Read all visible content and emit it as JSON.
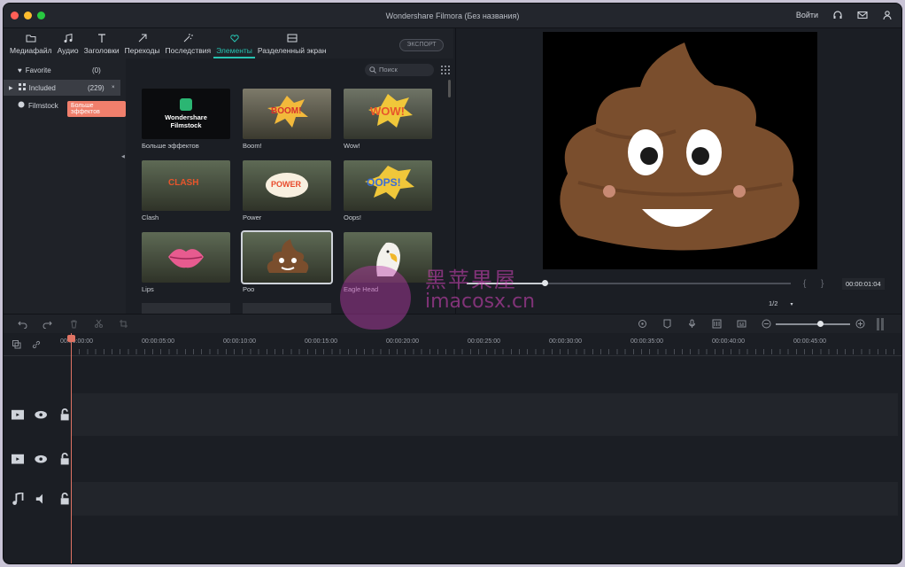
{
  "window": {
    "title": "Wondershare Filmora (Без названия)"
  },
  "titlebar": {
    "login_label": "Войти"
  },
  "toolbar": {
    "tabs": [
      {
        "label": "Медиафайл",
        "icon": "folder-icon"
      },
      {
        "label": "Аудио",
        "icon": "music-note-icon"
      },
      {
        "label": "Заголовки",
        "icon": "text-title-icon"
      },
      {
        "label": "Переходы",
        "icon": "transition-icon"
      },
      {
        "label": "Последствия",
        "icon": "effects-icon"
      },
      {
        "label": "Элементы",
        "icon": "elements-icon",
        "active": true
      },
      {
        "label": "Разделенный экран",
        "icon": "split-screen-icon"
      }
    ],
    "export_label": "ЭКСПОРТ"
  },
  "sidebar": {
    "items": [
      {
        "label": "Favorite",
        "count": "(0)"
      },
      {
        "label": "Included",
        "count": "(229)"
      },
      {
        "label": "Filmstock",
        "count": ""
      }
    ],
    "tooltip": "Больше эффектов"
  },
  "library": {
    "search_placeholder": "Поиск",
    "items": [
      {
        "label": "Больше эффектов",
        "caption": "Wondershare Filmstock"
      },
      {
        "label": "Boom!",
        "caption": "BOOM!"
      },
      {
        "label": "Wow!",
        "caption": "WOW!"
      },
      {
        "label": "Clash",
        "caption": "CLASH"
      },
      {
        "label": "Power",
        "caption": "POWER"
      },
      {
        "label": "Oops!",
        "caption": "OOPS!"
      },
      {
        "label": "Lips",
        "caption": ""
      },
      {
        "label": "Poo",
        "caption": ""
      },
      {
        "label": "Eagle Head",
        "caption": ""
      }
    ]
  },
  "preview": {
    "timecode": "00:00:01:04",
    "progress": 0.24,
    "ratio": "1/2"
  },
  "timeline": {
    "ruler": [
      "00:00:00:00",
      "00:00:05:00",
      "00:00:10:00",
      "00:00:15:00",
      "00:00:20:00",
      "00:00:25:00",
      "00:00:30:00",
      "00:00:35:00",
      "00:00:40:00",
      "00:00:45:00"
    ],
    "zoom": 0.6
  },
  "watermark": {
    "cn": "黑苹果屋",
    "domain": "imacosx.cn"
  },
  "colors": {
    "accent": "#27c4b2",
    "playhead": "#e07464",
    "tooltip": "#f07f6c"
  }
}
